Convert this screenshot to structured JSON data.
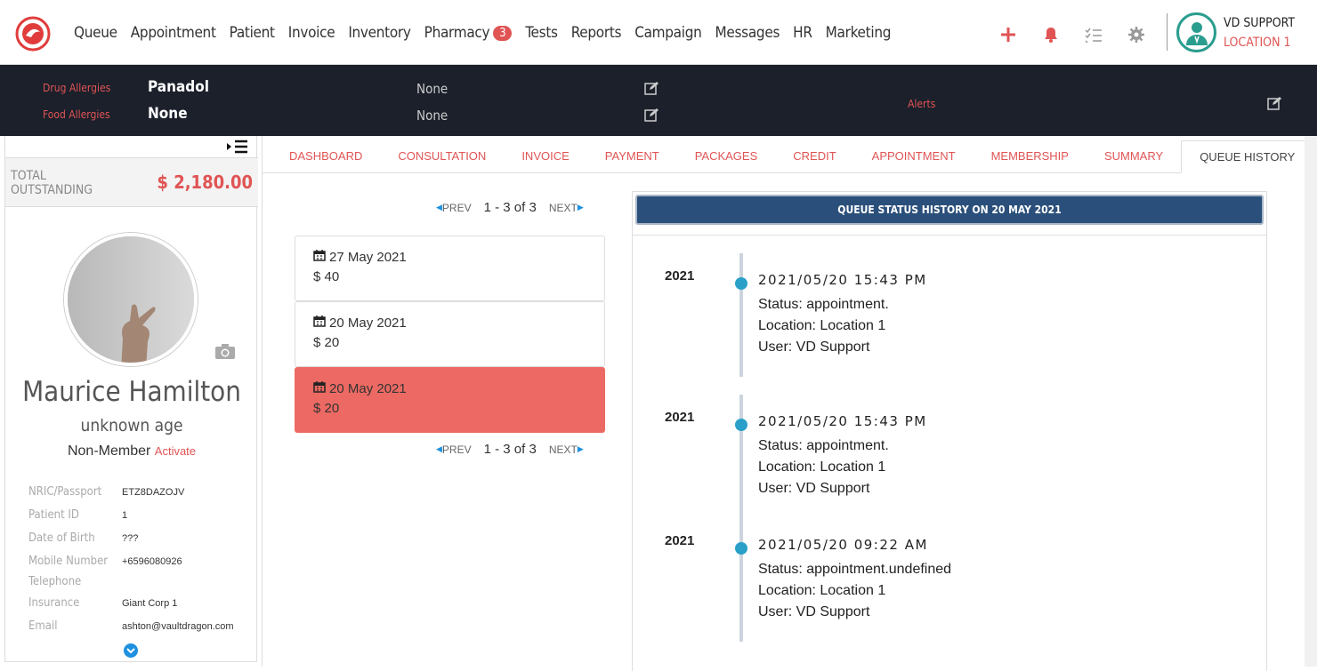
{
  "nav": {
    "items": [
      "Queue",
      "Appointment",
      "Patient",
      "Invoice",
      "Inventory",
      "Pharmacy",
      "Tests",
      "Reports",
      "Campaign",
      "Messages",
      "HR",
      "Marketing"
    ],
    "pharmacy_badge": "3"
  },
  "user": {
    "name": "VD SUPPORT",
    "location": "LOCATION 1"
  },
  "allergies": {
    "drug_label": "Drug Allergies",
    "drug_value": "Panadol",
    "drug_note": "None",
    "food_label": "Food Allergies",
    "food_value": "None",
    "food_note": "None",
    "alerts_label": "Alerts"
  },
  "sidebar": {
    "outstanding_label": "TOTAL OUTSTANDING",
    "outstanding_value": "$ 2,180.00",
    "patient_name": "Maurice Hamilton",
    "age": "unknown age",
    "membership": "Non-Member",
    "activate": "Activate",
    "fields": [
      {
        "label": "NRIC/Passport",
        "value": "ETZ8DAZOJV"
      },
      {
        "label": "Patient ID",
        "value": "1"
      },
      {
        "label": "Date of Birth",
        "value": "???"
      },
      {
        "label": "Mobile Number",
        "value": "+6596080926"
      },
      {
        "label": "Telephone",
        "value": ""
      },
      {
        "label": "Insurance",
        "value": "Giant Corp 1"
      },
      {
        "label": "Email",
        "value": "ashton@vaultdragon.com"
      }
    ]
  },
  "tabs": [
    "DASHBOARD",
    "CONSULTATION",
    "INVOICE",
    "PAYMENT",
    "PACKAGES",
    "CREDIT",
    "APPOINTMENT",
    "MEMBERSHIP",
    "SUMMARY",
    "QUEUE HISTORY"
  ],
  "active_tab": "QUEUE HISTORY",
  "pager": {
    "prev": "PREV",
    "next": "NEXT",
    "count": "1 - 3 of 3"
  },
  "queue_items": [
    {
      "date": "27 May 2021",
      "amount": "$ 40"
    },
    {
      "date": "20 May 2021",
      "amount": "$ 20"
    },
    {
      "date": "20 May 2021",
      "amount": "$ 20",
      "selected": true
    }
  ],
  "history": {
    "title": "QUEUE STATUS HISTORY ON 20 MAY 2021",
    "entries": [
      {
        "year": "2021",
        "time": "2021/05/20 15:43 PM",
        "status": "Status:  appointment.",
        "location": "Location: Location 1",
        "user": "User: VD Support"
      },
      {
        "year": "2021",
        "time": "2021/05/20 15:43 PM",
        "status": "Status:  appointment.",
        "location": "Location: Location 1",
        "user": "User: VD Support"
      },
      {
        "year": "2021",
        "time": "2021/05/20 09:22 AM",
        "status": "Status:  appointment.undefined",
        "location": "Location: Location 1",
        "user": "User: VD Support"
      }
    ]
  },
  "colors": {
    "accent": "#e05454",
    "dark_bar": "#1b202b",
    "header_blue": "#2a4f7a",
    "selected_item": "#ec6a63",
    "timeline_dot": "#2aa0c9"
  },
  "icons": [
    "logo-icon",
    "plus-icon",
    "bell-icon",
    "checklist-icon",
    "gear-icon",
    "doctor-avatar-icon",
    "edit-icon",
    "sidebar-toggle-icon",
    "camera-icon",
    "calendar-icon",
    "chevron-down-icon"
  ]
}
